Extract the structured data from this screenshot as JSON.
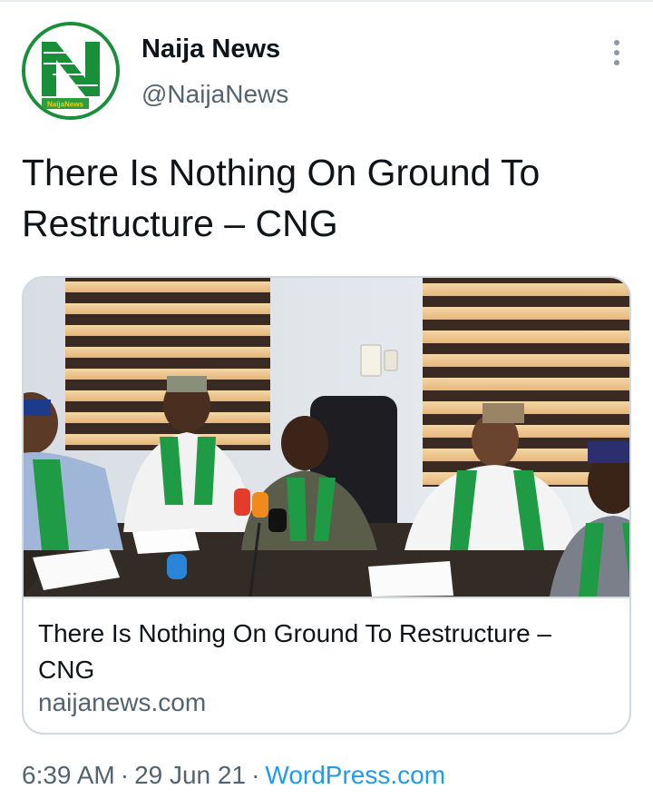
{
  "author": {
    "name": "Naija News",
    "handle": "@NaijaNews",
    "avatar_icon": "naija-news-logo",
    "avatar_caption": "NaijaNews"
  },
  "tweet": {
    "text": "There Is Nothing On Ground To Restructure – CNG"
  },
  "card": {
    "image_icon": "press-conference-photo",
    "title": "There Is Nothing On Ground To Restructure – CNG",
    "domain": "naijanews.com"
  },
  "meta": {
    "time": "6:39 AM",
    "separator": "·",
    "date": "29 Jun 21",
    "source": "WordPress.com"
  },
  "icons": {
    "more": "more-vertical-icon"
  },
  "colors": {
    "brand_green": "#1a8f3a",
    "link_blue": "#1d9bf0",
    "secondary_text": "#536471"
  }
}
